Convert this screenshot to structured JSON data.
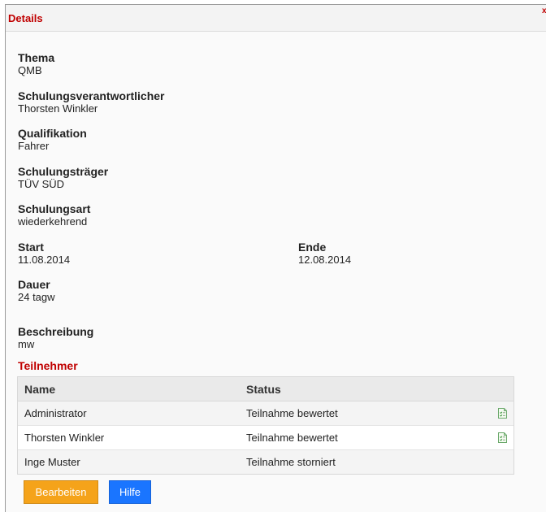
{
  "dialog": {
    "title": "Details",
    "close_label": "x"
  },
  "fields": {
    "thema": {
      "label": "Thema",
      "value": "QMB"
    },
    "verantwortlicher": {
      "label": "Schulungsverantwortlicher",
      "value": "Thorsten Winkler"
    },
    "qualifikation": {
      "label": "Qualifikation",
      "value": "Fahrer"
    },
    "traeger": {
      "label": "Schulungsträger",
      "value": "TÜV SÜD"
    },
    "art": {
      "label": "Schulungsart",
      "value": "wiederkehrend"
    },
    "start": {
      "label": "Start",
      "value": "11.08.2014"
    },
    "ende": {
      "label": "Ende",
      "value": "12.08.2014"
    },
    "dauer": {
      "label": "Dauer",
      "value": "24 tagw"
    },
    "beschreibung": {
      "label": "Beschreibung",
      "value": "mw"
    }
  },
  "participants": {
    "title": "Teilnehmer",
    "columns": [
      "Name",
      "Status"
    ],
    "rows": [
      {
        "name": "Administrator",
        "status": "Teilnahme bewertet",
        "icon": "evaluation-document-icon"
      },
      {
        "name": "Thorsten Winkler",
        "status": "Teilnahme bewertet",
        "icon": "evaluation-document-icon"
      },
      {
        "name": "Inge Muster",
        "status": "Teilnahme storniert",
        "icon": ""
      }
    ]
  },
  "buttons": {
    "edit_label": "Bearbeiten",
    "help_label": "Hilfe"
  },
  "colors": {
    "accent_red": "#c00000",
    "edit_button": "#f5a31a",
    "help_button": "#1a75ff",
    "icon_green": "#3a9a3a"
  }
}
